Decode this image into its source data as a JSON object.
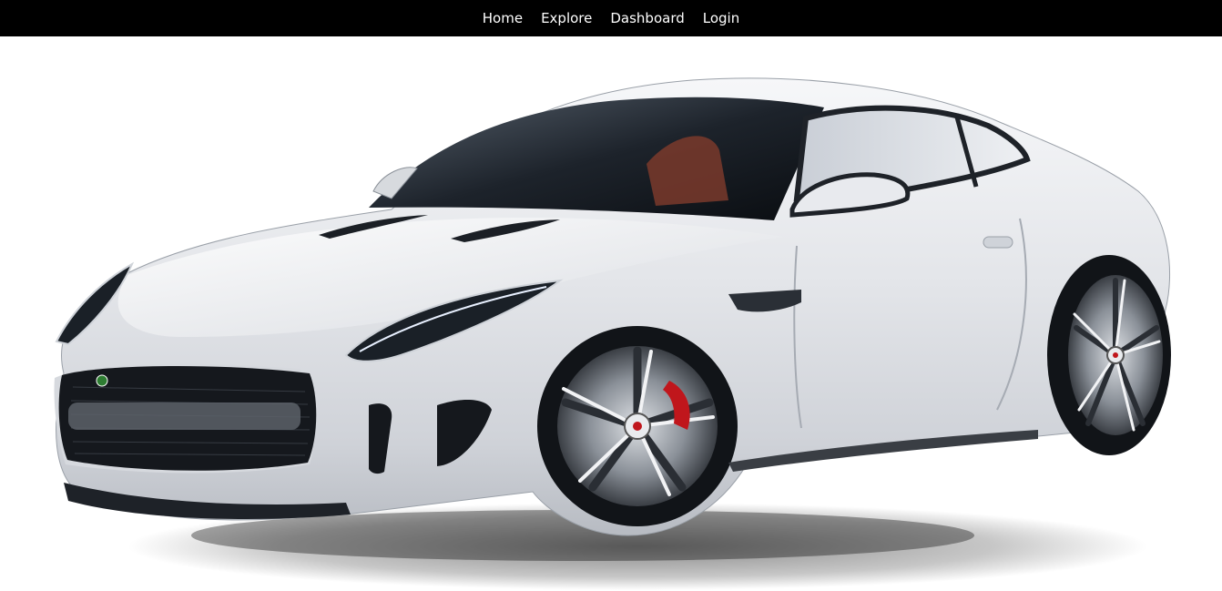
{
  "nav": {
    "items": [
      {
        "label": "Home"
      },
      {
        "label": "Explore"
      },
      {
        "label": "Dashboard"
      },
      {
        "label": "Login"
      }
    ]
  },
  "colors": {
    "nav_background": "#000000",
    "nav_text": "#ffffff",
    "page_background": "#ffffff",
    "car_body": "#e4e6ea",
    "brake_caliper": "#c0161c"
  },
  "hero": {
    "image": "sports-car-photo"
  }
}
